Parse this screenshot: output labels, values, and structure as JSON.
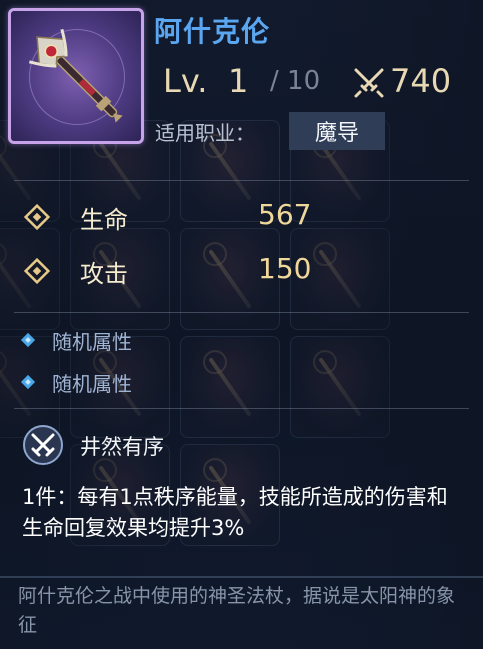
{
  "item": {
    "name": "阿什克伦",
    "level_label": "Lv.",
    "level": "1",
    "level_max": "/ 10",
    "power": "740",
    "job_label": "适用职业：",
    "job": "魔导",
    "frame_color": "#c7a4ea",
    "icon": "staff-weapon-icon"
  },
  "stats": [
    {
      "name": "生命",
      "value": "567"
    },
    {
      "name": "攻击",
      "value": "150"
    }
  ],
  "random_attrs": [
    "随机属性",
    "随机属性"
  ],
  "set_bonus": {
    "name": "井然有序",
    "icon": "crossed-swords-icon",
    "description": "1件：每有1点秩序能量，技能所造成的伤害和生命回复效果均提升3%"
  },
  "lore": "阿什克伦之战中使用的神圣法杖，据说是太阳神的象征",
  "colors": {
    "title": "#5aa6f0",
    "level": "#e8d9b4",
    "stat_value": "#f0d79a",
    "random_attr": "#9fb3d3",
    "lore": "#8794aa"
  }
}
